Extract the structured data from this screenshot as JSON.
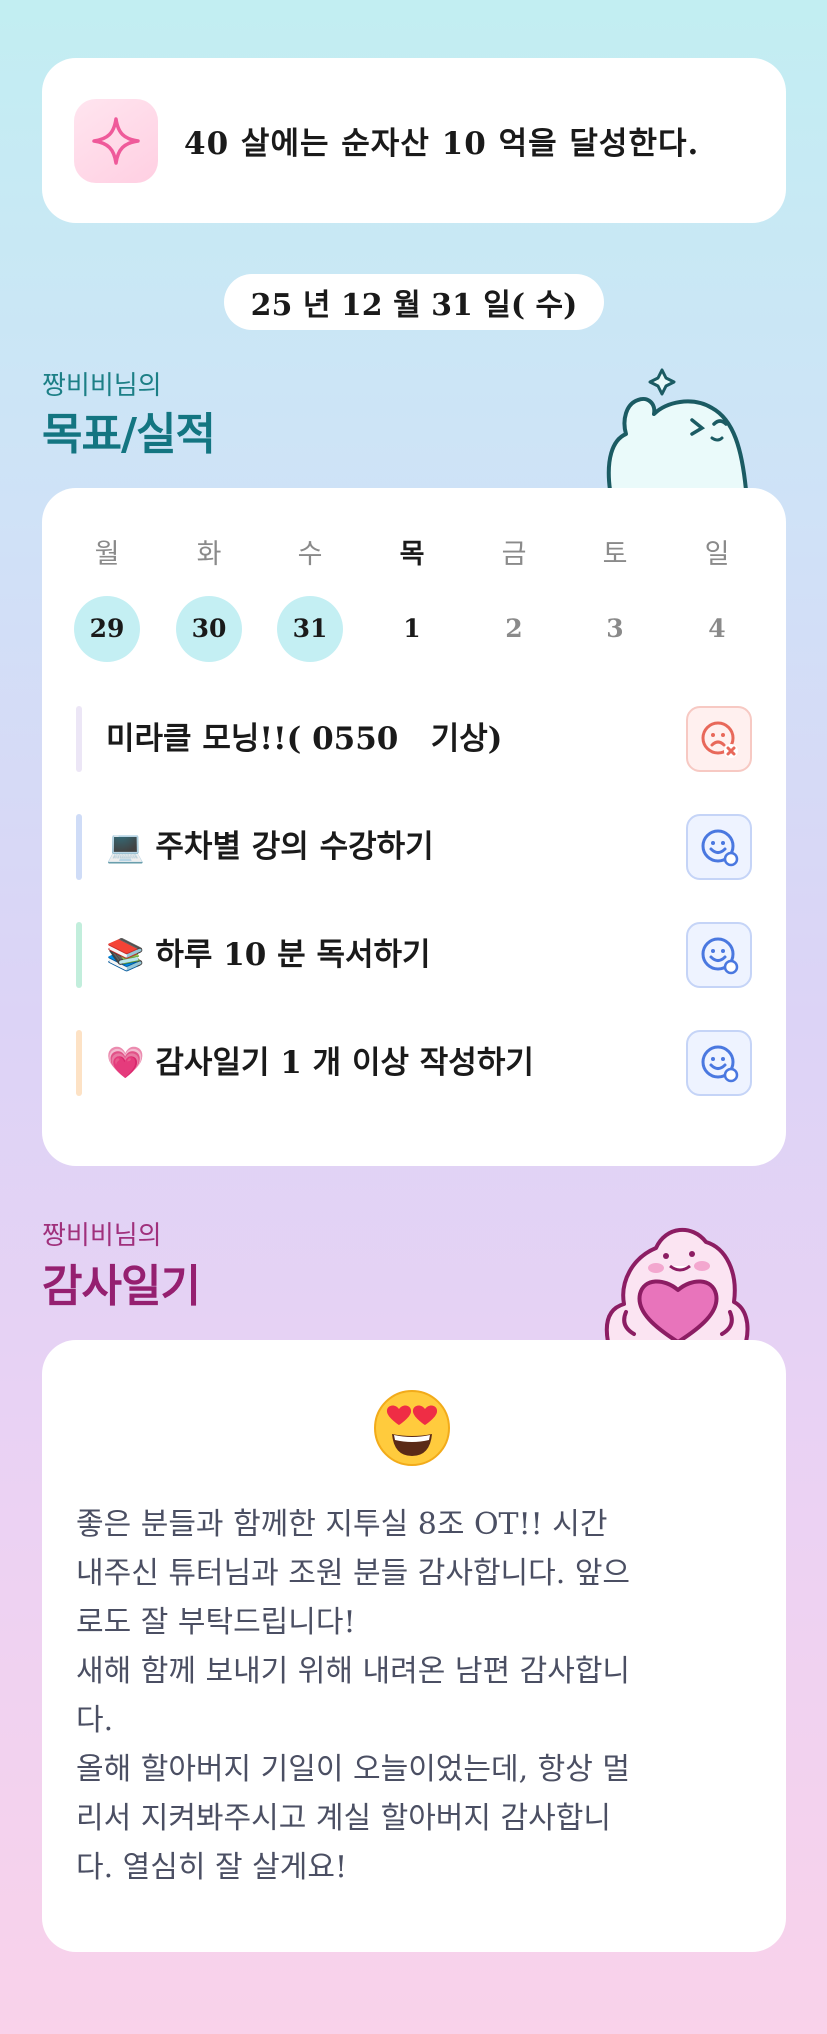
{
  "goal": {
    "icon": "sparkle-icon",
    "text": "40 살에는 순자산 10 억을 달성한다."
  },
  "date_label": "25 년 12 월 31 일( 수)",
  "goals_section": {
    "subtitle": "짱비비님의",
    "title": "목표/실적"
  },
  "calendar": {
    "weekdays": [
      "월",
      "화",
      "수",
      "목",
      "금",
      "토",
      "일"
    ],
    "dates": [
      "29",
      "30",
      "31",
      "1",
      "2",
      "3",
      "4"
    ],
    "done_dates": [
      "29",
      "30",
      "31"
    ],
    "today": "1"
  },
  "tasks": [
    {
      "emoji": "",
      "label": "미라클 모닝!!( 0550   기상)",
      "status": "failed",
      "bar_color": "#ece6f6"
    },
    {
      "emoji": "💻",
      "label": "주차별 강의 수강하기",
      "status": "done",
      "bar_color": "#cfdcf7"
    },
    {
      "emoji": "📚",
      "label": "하루 10 분 독서하기",
      "status": "done",
      "bar_color": "#c2eedc"
    },
    {
      "emoji": "💗",
      "label": "감사일기 1 개 이상 작성하기",
      "status": "done",
      "bar_color": "#fde2c5"
    }
  ],
  "gratitude_section": {
    "subtitle": "짱비비님의",
    "title": "감사일기",
    "emoji": "heart-eyes-emoji",
    "text": "좋은 분들과 함께한 지투실 8조 OT!! 시간\n내주신 튜터님과 조원 분들 감사합니다. 앞으\n로도 잘 부탁드립니다!\n새해 함께 보내기 위해 내려온 남편 감사합니\n다.\n올해 할아버지 기일이 오늘이었는데, 항상 멀\n리서 지켜봐주시고 계실 할아버지 감사합니\n다. 열심히 잘 살게요!"
  },
  "colors": {
    "goal_title": "#137581",
    "gratitude_title": "#952070",
    "done_circle": "#c4eff3",
    "fail_icon": "#e8685a",
    "ok_icon": "#4a78e0"
  }
}
